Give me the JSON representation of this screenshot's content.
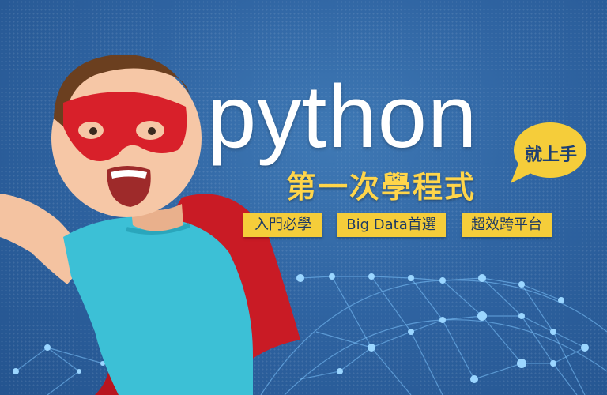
{
  "banner": {
    "title": "python",
    "subtitle": "第一次學程式",
    "bubble": "就上手",
    "tags": [
      "入門必學",
      "Big Data首選",
      "超效跨平台"
    ]
  },
  "colors": {
    "background": "#2f64a2",
    "accent_yellow": "#f5cd3a",
    "mask_red": "#d8202a",
    "shirt": "#3cc0d6",
    "title_text": "#ffffff",
    "tag_text": "#1e3a64"
  },
  "image": {
    "subject": "child-in-red-superhero-mask-and-cape",
    "background_motif": "network-globe"
  }
}
